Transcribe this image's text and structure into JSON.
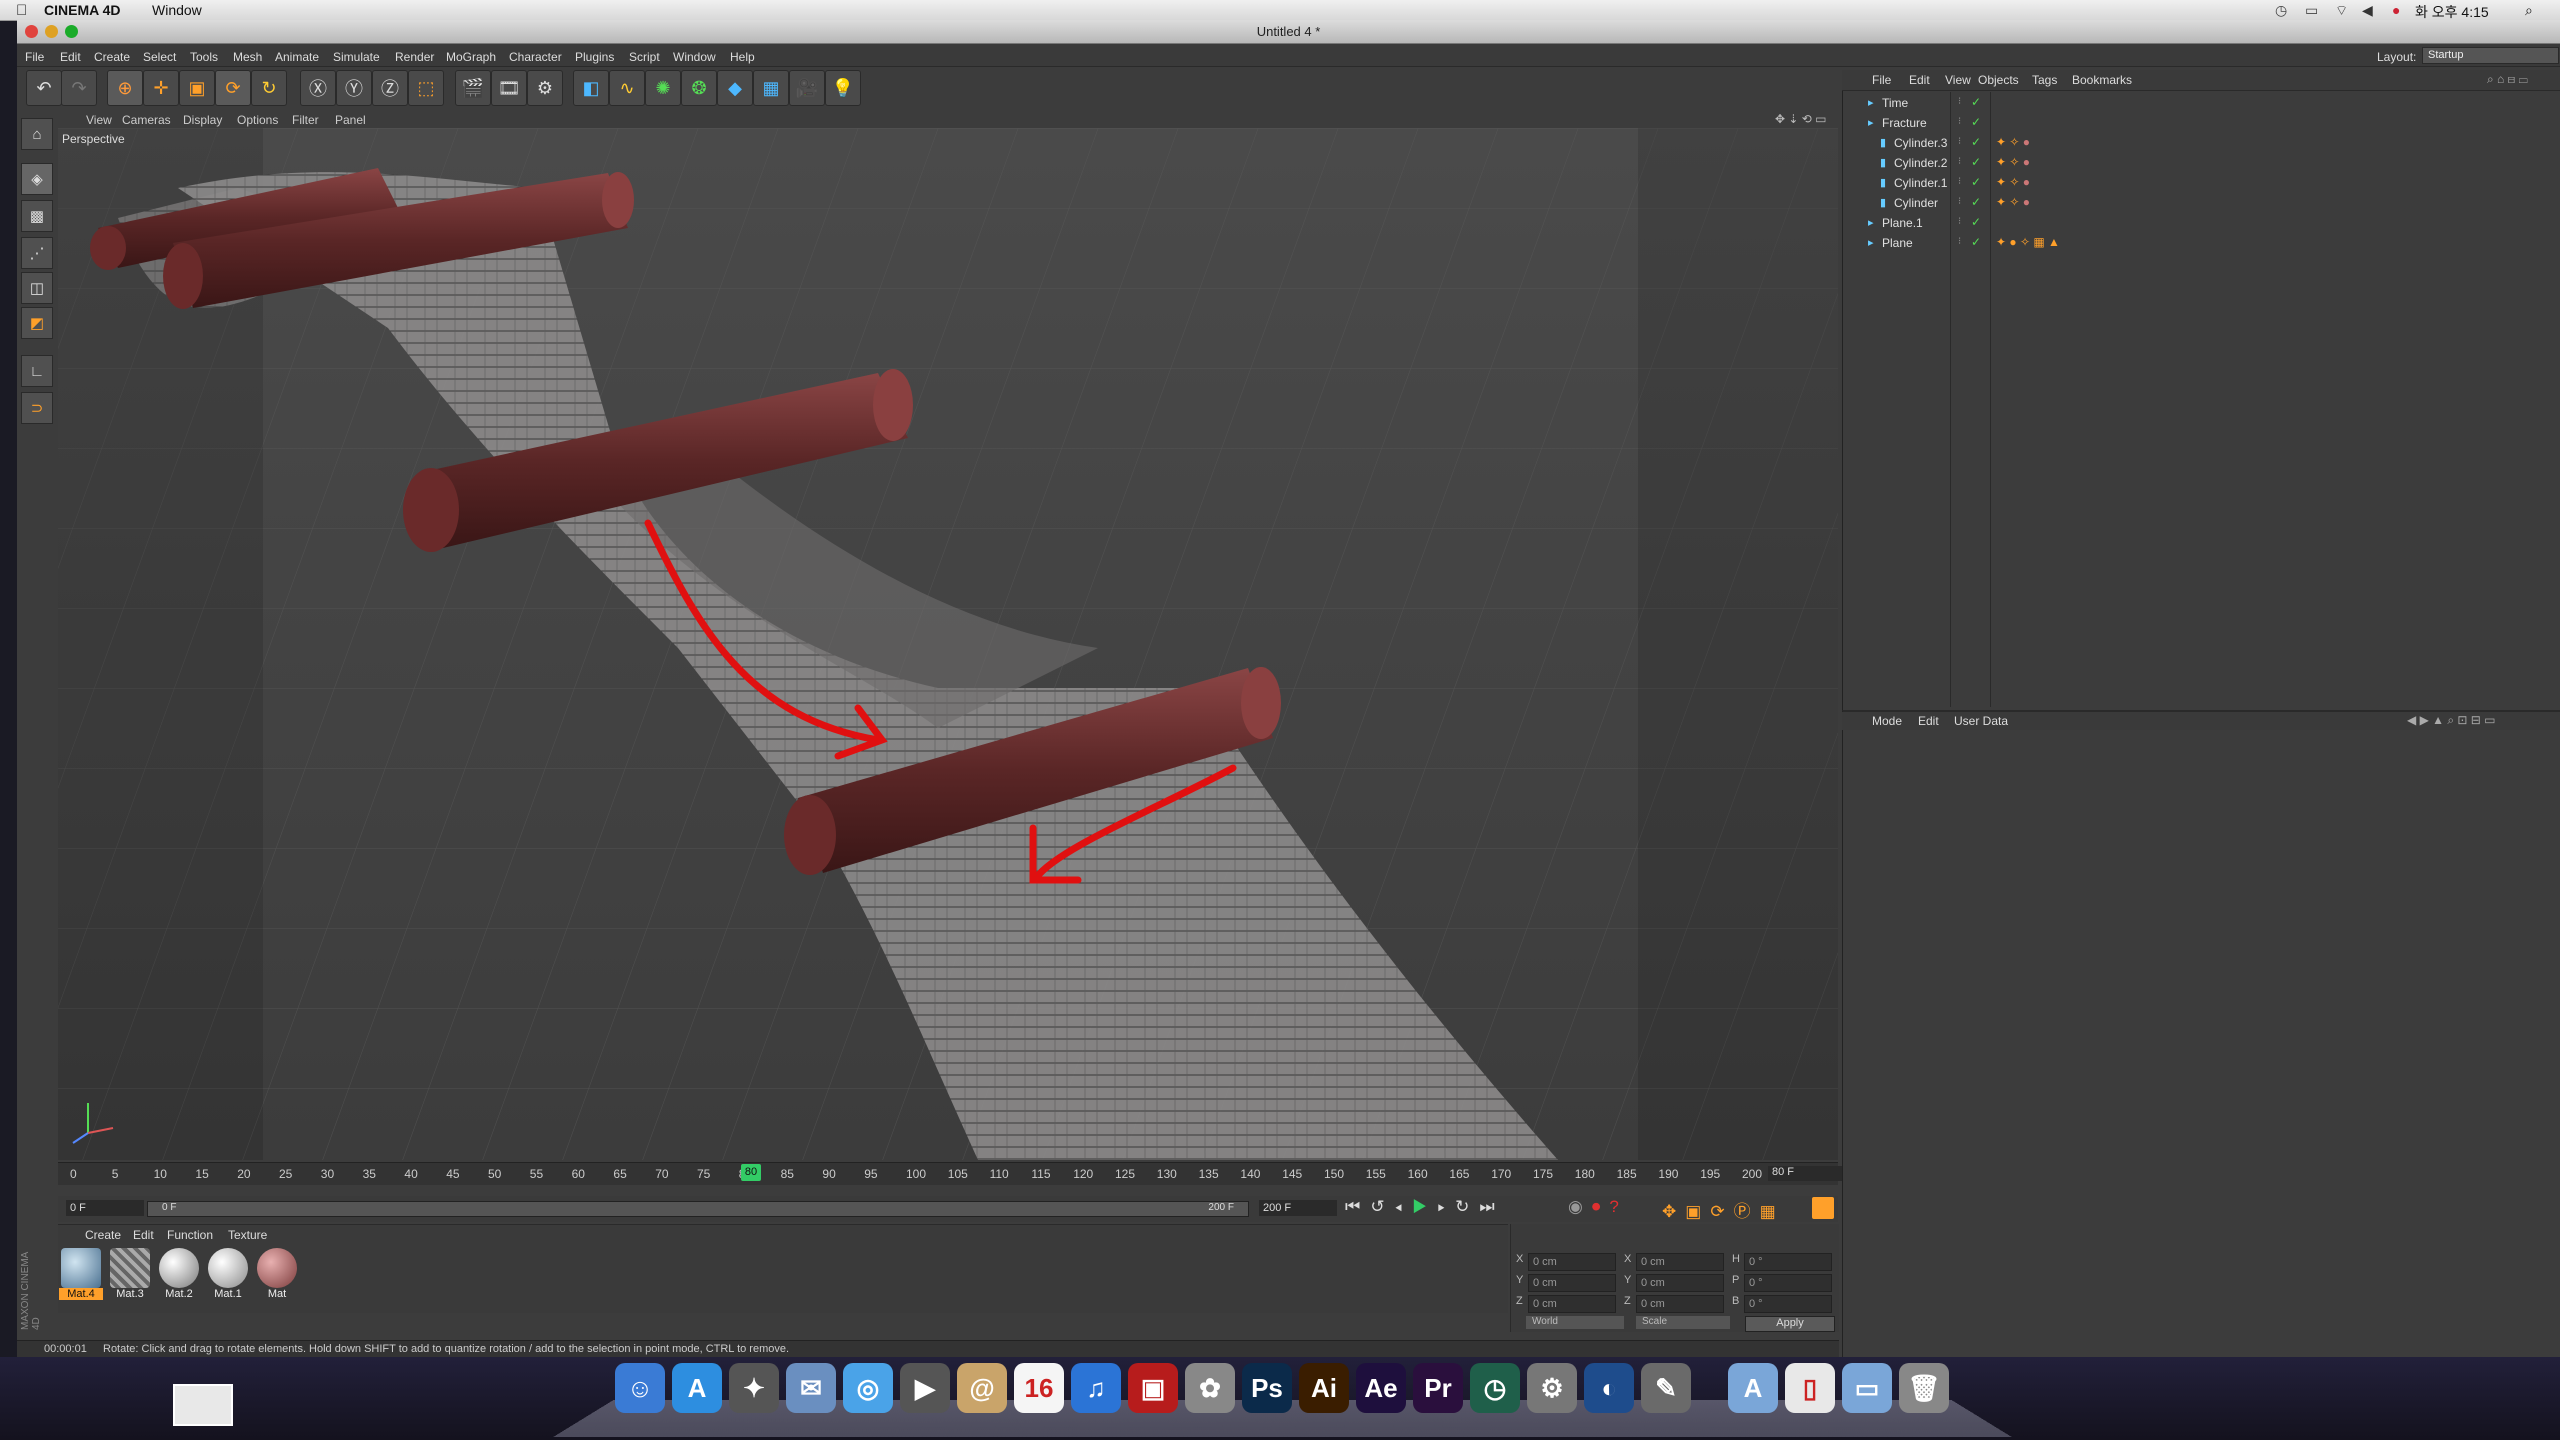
{
  "mac_menubar": {
    "app_name": "CINEMA 4D",
    "window_menu": "Window",
    "clock": "화 오후 4:15"
  },
  "window": {
    "title": "Untitled 4 *"
  },
  "main_menu": [
    "File",
    "Edit",
    "Create",
    "Select",
    "Tools",
    "Mesh",
    "Animate",
    "Simulate",
    "Render",
    "MoGraph",
    "Character",
    "Plugins",
    "Script",
    "Window",
    "Help"
  ],
  "layout": {
    "label": "Layout:",
    "value": "Startup"
  },
  "viewport": {
    "menu": [
      "View",
      "Cameras",
      "Display",
      "Options",
      "Filter",
      "Panel"
    ],
    "name": "Perspective"
  },
  "objects_panel": {
    "menu": [
      "File",
      "Edit",
      "View",
      "Objects",
      "Tags",
      "Bookmarks"
    ],
    "items": [
      {
        "label": "Time",
        "indent": 0
      },
      {
        "label": "Fracture",
        "indent": 0
      },
      {
        "label": "Cylinder.3",
        "indent": 1
      },
      {
        "label": "Cylinder.2",
        "indent": 1
      },
      {
        "label": "Cylinder.1",
        "indent": 1
      },
      {
        "label": "Cylinder",
        "indent": 1
      },
      {
        "label": "Plane.1",
        "indent": 0
      },
      {
        "label": "Plane",
        "indent": 0
      }
    ]
  },
  "attributes_panel": {
    "menu": [
      "Mode",
      "Edit",
      "User Data"
    ]
  },
  "timeline": {
    "ticks": [
      "0",
      "5",
      "10",
      "15",
      "20",
      "25",
      "30",
      "35",
      "40",
      "45",
      "50",
      "55",
      "60",
      "65",
      "70",
      "75",
      "80",
      "85",
      "90",
      "95",
      "100",
      "105",
      "110",
      "115",
      "120",
      "125",
      "130",
      "135",
      "140",
      "145",
      "150",
      "155",
      "160",
      "165",
      "170",
      "175",
      "180",
      "185",
      "190",
      "195",
      "200"
    ],
    "current_frame": "80",
    "current_frame_field": "80 F",
    "start_field": "0 F",
    "range_start": "0 F",
    "range_end": "200 F",
    "end_field": "200 F"
  },
  "material_manager": {
    "menu": [
      "Create",
      "Edit",
      "Function",
      "Texture"
    ],
    "materials": [
      {
        "label": "Mat.4",
        "color": "#8fb0c8",
        "selected": true
      },
      {
        "label": "Mat.3",
        "color": "#9a9a9a",
        "selected": false
      },
      {
        "label": "Mat.2",
        "color": "#d8d8d8",
        "selected": false
      },
      {
        "label": "Mat.1",
        "color": "#e8e8e8",
        "selected": false
      },
      {
        "label": "Mat",
        "color": "#b77a7a",
        "selected": false
      }
    ]
  },
  "coordinates": {
    "rows": [
      {
        "axis": "X",
        "pos": "0 cm",
        "axis2": "X",
        "size": "0 cm",
        "rot_axis": "H",
        "rot": "0 °"
      },
      {
        "axis": "Y",
        "pos": "0 cm",
        "axis2": "Y",
        "size": "0 cm",
        "rot_axis": "P",
        "rot": "0 °"
      },
      {
        "axis": "Z",
        "pos": "0 cm",
        "axis2": "Z",
        "size": "0 cm",
        "rot_axis": "B",
        "rot": "0 °"
      }
    ],
    "mode": "World",
    "scale": "Scale",
    "apply": "Apply"
  },
  "status": {
    "time": "00:00:01",
    "message": "Rotate: Click and drag to rotate elements. Hold down SHIFT to add to quantize rotation / add to the selection in point mode, CTRL to remove."
  },
  "dock": {
    "apps": [
      {
        "name": "finder-icon",
        "glyph": "☺",
        "color": "#3a7bd5"
      },
      {
        "name": "app-store-icon",
        "glyph": "A",
        "color": "#2d8ee0"
      },
      {
        "name": "launchpad-icon",
        "glyph": "✦",
        "color": "#555"
      },
      {
        "name": "mail-icon",
        "glyph": "✉",
        "color": "#6a8fc0"
      },
      {
        "name": "safari-icon",
        "glyph": "◎",
        "color": "#4aa3e8"
      },
      {
        "name": "facetime-icon",
        "glyph": "▶",
        "color": "#555"
      },
      {
        "name": "contacts-icon",
        "glyph": "@",
        "color": "#c9a46a"
      },
      {
        "name": "calendar-icon",
        "glyph": "16",
        "color": "#f5f5f5"
      },
      {
        "name": "itunes-icon",
        "glyph": "♫",
        "color": "#2b74d6"
      },
      {
        "name": "photo-booth-icon",
        "glyph": "▣",
        "color": "#b71c1c"
      },
      {
        "name": "iphoto-icon",
        "glyph": "✿",
        "color": "#888"
      },
      {
        "name": "photoshop-icon",
        "glyph": "Ps",
        "color": "#0b2a4a"
      },
      {
        "name": "illustrator-icon",
        "glyph": "Ai",
        "color": "#3a1d00"
      },
      {
        "name": "after-effects-icon",
        "glyph": "Ae",
        "color": "#1e0f3d"
      },
      {
        "name": "premiere-icon",
        "glyph": "Pr",
        "color": "#2a0f3d"
      },
      {
        "name": "time-machine-icon",
        "glyph": "◷",
        "color": "#1f5f4a"
      },
      {
        "name": "system-preferences-icon",
        "glyph": "⚙",
        "color": "#777"
      },
      {
        "name": "cinema4d-icon",
        "glyph": "◐",
        "color": "#1e4c8c"
      },
      {
        "name": "preview-icon",
        "glyph": "✎",
        "color": "#6a6a6a"
      },
      {
        "name": "applications-folder-icon",
        "glyph": "A",
        "color": "#7aa6d8"
      },
      {
        "name": "document-icon",
        "glyph": "▯",
        "color": "#e8e8e8"
      },
      {
        "name": "downloads-folder-icon",
        "glyph": "▭",
        "color": "#7aa6d8"
      },
      {
        "name": "trash-icon",
        "glyph": "🗑",
        "color": "#888"
      }
    ]
  }
}
